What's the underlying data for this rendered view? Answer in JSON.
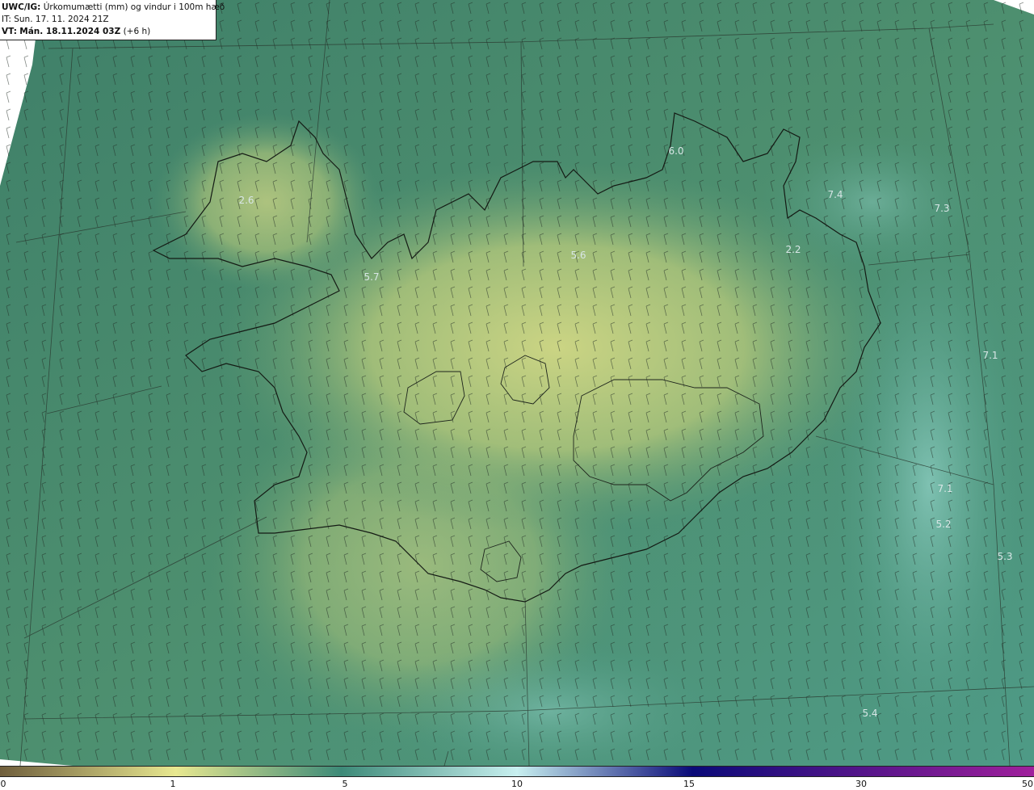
{
  "header": {
    "model": "UWC/IG:",
    "field": "Úrkomumætti (mm) og vindur i 100m hæð",
    "init_time": "IT: Sun. 17. 11. 2024 21Z",
    "valid_prefix": "VT:",
    "valid_time": "Mán. 18.11.2024 03Z",
    "lead": "(+6 h)"
  },
  "colors": {
    "low": "#6f5e3c",
    "yellow": "#e8e890",
    "teal": "#3d8a78",
    "cyan": "#c8f0f0",
    "navy": "#0a0a78",
    "magenta": "#a0209c"
  },
  "value_labels": [
    {
      "text": "6.0",
      "id": "north"
    },
    {
      "text": "2.6",
      "id": "westfjords"
    },
    {
      "text": "5.7",
      "id": "west"
    },
    {
      "text": "5.6",
      "id": "north-central"
    },
    {
      "text": "7.4",
      "id": "northeast-sea"
    },
    {
      "text": "7.3",
      "id": "northeast-sea-2"
    },
    {
      "text": "2.2",
      "id": "east"
    },
    {
      "text": "7.1",
      "id": "east-sea"
    },
    {
      "text": "7.1",
      "id": "southeast-sea"
    },
    {
      "text": "5.2",
      "id": "southeast-sea-2"
    },
    {
      "text": "5.3",
      "id": "southeast-sea-3"
    },
    {
      "text": "5.4",
      "id": "south-sea"
    }
  ],
  "colorbar": {
    "ticks": [
      "0",
      "1",
      "5",
      "10",
      "15",
      "30",
      "50"
    ]
  }
}
